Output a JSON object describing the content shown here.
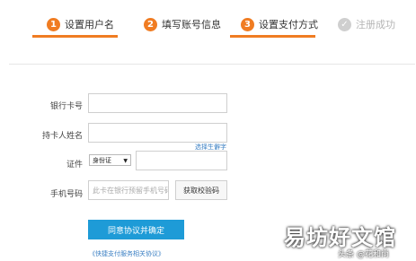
{
  "steps": [
    {
      "number": "1",
      "label": "设置用户名",
      "color": "#f07c22"
    },
    {
      "number": "2",
      "label": "填写账号信息",
      "color": "#f07c22"
    },
    {
      "number": "3",
      "label": "设置支付方式",
      "color": "#f07c22"
    },
    {
      "icon": "check-circle-icon",
      "label": "注册成功",
      "color": "#cfcfcf"
    }
  ],
  "form": {
    "card_number_label": "银行卡号",
    "holder_name_label": "持卡人姓名",
    "rare_char_link": "选择生僻字",
    "id_label": "证件",
    "id_type_value": "身份证",
    "phone_label": "手机号码",
    "phone_placeholder": "此卡在银行预留手机号码",
    "get_code_button": "获取校验码",
    "submit_button": "同意协议并确定",
    "agreement_link": "《快捷支付服务相关协议》"
  },
  "watermark": {
    "main": "易坊好文馆",
    "sub": "头条 @花和尚"
  },
  "colors": {
    "accent": "#f07c22",
    "primary_button": "#1e9bd7",
    "link": "#3a7fc3"
  }
}
